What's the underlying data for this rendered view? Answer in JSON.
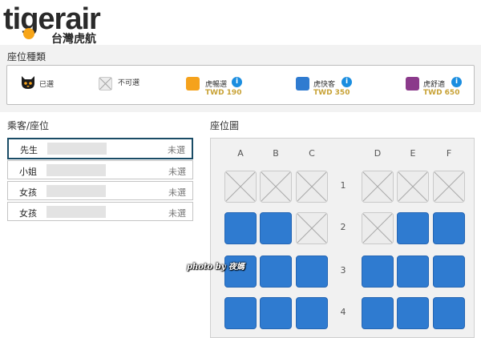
{
  "brand": {
    "wordmark": "tigerair",
    "subtitle": "台灣虎航",
    "accent": "#f7a518"
  },
  "seat_type_section": {
    "title": "座位種類"
  },
  "legend": [
    {
      "key": "selected",
      "label": "已選",
      "icon": "tiger-head-icon"
    },
    {
      "key": "unavailable",
      "label": "不可選",
      "icon": "x-icon"
    },
    {
      "key": "standard",
      "label": "虎暢選",
      "price": "TWD 190",
      "color": "#f5a21c"
    },
    {
      "key": "express",
      "label": "虎快客",
      "price": "TWD 350",
      "color": "#2f7bd0"
    },
    {
      "key": "comfort",
      "label": "虎舒適",
      "price": "TWD 650",
      "color": "#8b3a8b"
    }
  ],
  "info_symbol": "i",
  "passengers_section": {
    "title": "乘客/座位"
  },
  "passengers": [
    {
      "title": "先生",
      "status": "未選"
    },
    {
      "title": "小姐",
      "status": "未選"
    },
    {
      "title": "女孩",
      "status": "未選"
    },
    {
      "title": "女孩",
      "status": "未選"
    }
  ],
  "seatmap_section": {
    "title": "座位圖"
  },
  "seatmap": {
    "columns": [
      "A",
      "B",
      "C",
      "D",
      "E",
      "F"
    ],
    "rows": [
      {
        "number": "1",
        "seats": [
          "unavailable",
          "unavailable",
          "unavailable",
          "unavailable",
          "unavailable",
          "unavailable"
        ]
      },
      {
        "number": "2",
        "seats": [
          "available",
          "available",
          "unavailable",
          "unavailable",
          "available",
          "available"
        ]
      },
      {
        "number": "3",
        "seats": [
          "available",
          "available",
          "available",
          "available",
          "available",
          "available"
        ]
      },
      {
        "number": "4",
        "seats": [
          "available",
          "available",
          "available",
          "available",
          "available",
          "available"
        ]
      }
    ]
  },
  "watermark": "photo by 夜媽"
}
